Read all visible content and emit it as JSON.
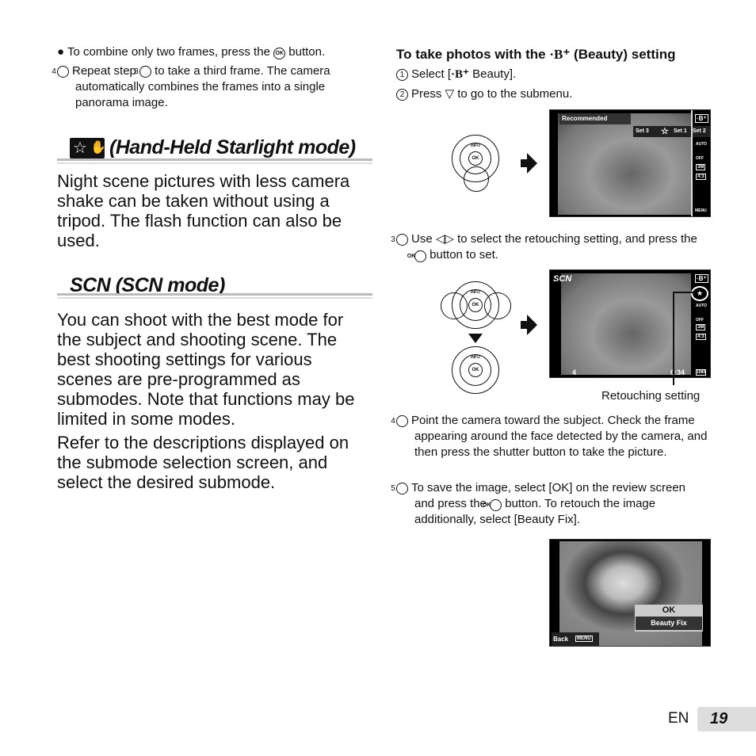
{
  "left": {
    "bullet_text": "To combine only two frames, press the",
    "bullet_ok": "OK",
    "bullet_tail": "button.",
    "step4_num": "4",
    "step4_a": "Repeat step",
    "step4_ref": "3",
    "step4_b": "to take a third frame. The camera automatically combines the frames into a single panorama image.",
    "heading1": "(Hand-Held Starlight mode)",
    "para1": "Night scene pictures with less camera shake can be taken without using a tripod. The flash function can also be used.",
    "heading2": "SCN (SCN mode)",
    "para2": "You can shoot with the best mode for the subject and shooting scene. The best shooting settings for various scenes are pre-programmed as submodes. Note that functions may be limited in some modes.",
    "para3": "Refer to the descriptions displayed on the submode selection screen, and select the desired submode."
  },
  "right": {
    "title_a": "To take photos with the",
    "title_b": "(Beauty) setting",
    "steps": [
      {
        "num": "1",
        "text": "Select [",
        "tail": " Beauty]."
      },
      {
        "num": "2",
        "text": "Press",
        "tail": "to go to the submenu."
      },
      {
        "num": "3",
        "text": "Use",
        "tail": "to select the retouching setting, and press the",
        "tail2": "button to set."
      },
      {
        "num": "4",
        "text": "Point the camera toward the subject. Check the frame appearing around the face detected by the camera, and then press the shutter button to take the picture."
      },
      {
        "num": "5",
        "text": "To save the image, select [OK] on the review screen and press the",
        "tail": "button. To retouch the image additionally, select [Beauty Fix]."
      }
    ],
    "ok": "OK",
    "callout": "Retouching setting"
  },
  "dial": {
    "info": "INFO",
    "ok": "OK"
  },
  "screen1": {
    "recommended": "Recommended",
    "set3": "Set 3",
    "set1": "Set 1",
    "set2": "Set 2",
    "flash": "AUTO",
    "timer": "OFF",
    "size": "3M",
    "aspect": "4:3",
    "menu": "MENU"
  },
  "screen2": {
    "mode": "SCN",
    "flash": "AUTO",
    "timer": "OFF",
    "size": "3M",
    "aspect": "4:3",
    "count": "4",
    "time": "0:34",
    "video": "1080"
  },
  "screen3": {
    "ok": "OK",
    "beauty_fix": "Beauty Fix",
    "back": "Back",
    "menu": "MENU"
  },
  "footer": {
    "lang": "EN",
    "page": "19"
  }
}
